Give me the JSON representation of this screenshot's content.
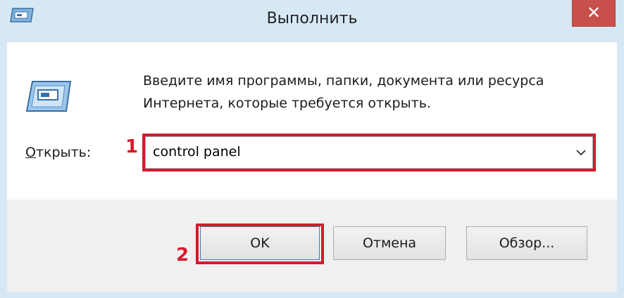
{
  "window": {
    "title": "Выполнить",
    "close_label": "✕"
  },
  "prompt": {
    "line1": "Введите имя программы, папки, документа или ресурса",
    "line2": "Интернета, которые требуется открыть."
  },
  "open": {
    "label_accel": "О",
    "label_rest": "ткрыть:",
    "value": "control panel"
  },
  "buttons": {
    "ok": "OK",
    "cancel": "Отмена",
    "browse": "Обзор..."
  },
  "annotations": {
    "marker1": "1",
    "marker2": "2",
    "highlight_color": "#d8192a"
  },
  "icons": {
    "app_icon": "run-dialog-icon",
    "dropdown": "chevron-down-icon"
  }
}
